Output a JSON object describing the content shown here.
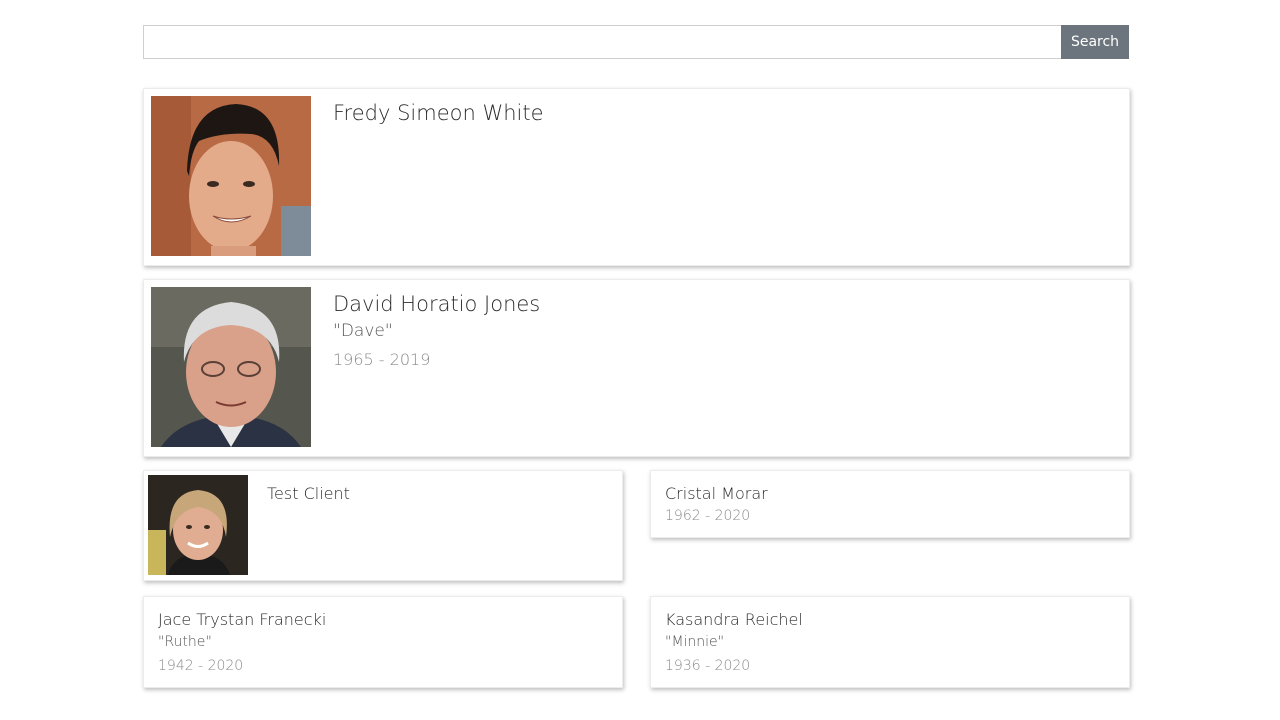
{
  "search": {
    "value": "",
    "placeholder": "",
    "button_label": "Search"
  },
  "people": [
    {
      "name": "Fredy Simeon White",
      "nickname": "",
      "years": "",
      "has_photo": true
    },
    {
      "name": "David Horatio Jones",
      "nickname": "\"Dave\"",
      "years": "1965 - 2019",
      "has_photo": true
    },
    {
      "name": "Test Client",
      "nickname": "",
      "years": "",
      "has_photo": true
    },
    {
      "name": "Cristal Morar",
      "nickname": "",
      "years": "1962 - 2020",
      "has_photo": false
    },
    {
      "name": "Jace Trystan Franecki",
      "nickname": "\"Ruthe\"",
      "years": "1942 - 2020",
      "has_photo": false
    },
    {
      "name": "Kasandra Reichel",
      "nickname": "\"Minnie\"",
      "years": "1936 - 2020",
      "has_photo": false
    }
  ],
  "colors": {
    "button_bg": "#6c757d",
    "card_border": "#ececec",
    "muted_text": "#8a8a8a"
  }
}
